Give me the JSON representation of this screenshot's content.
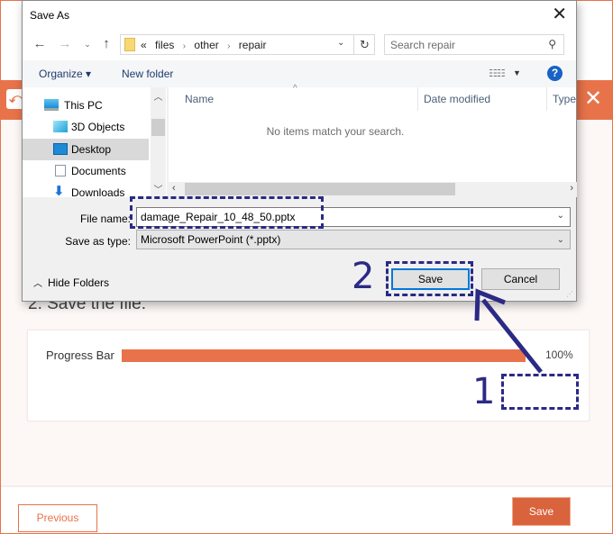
{
  "app": {
    "logo_glyph": "⤺",
    "close_glyph": "✕",
    "step_title": "2. Save the file:",
    "progress": {
      "label": "Progress Bar",
      "value_percent": 100,
      "value_text": "100%"
    },
    "save_button": "Save",
    "previous_button": "Previous",
    "accent_color": "#e8734a"
  },
  "dialog": {
    "title": "Save As",
    "close_glyph": "✕",
    "nav": {
      "back_glyph": "←",
      "forward_glyph": "→",
      "recent_glyph": "⌄",
      "up_glyph": "↑"
    },
    "address": {
      "overflow": "«",
      "crumbs": [
        "files",
        "other",
        "repair"
      ],
      "separator": "›",
      "dropdown_glyph": "⌄",
      "refresh_glyph": "↻"
    },
    "search": {
      "placeholder": "Search repair",
      "value": ""
    },
    "commands": {
      "organize": "Organize ▾",
      "new_folder": "New folder",
      "view_glyph": "☷☷",
      "view_drop_glyph": "▼",
      "help_glyph": "?"
    },
    "nav_pane": {
      "items": [
        {
          "label": "This PC",
          "icon": "computer-icon",
          "selected": false
        },
        {
          "label": "3D Objects",
          "icon": "3d-objects-icon",
          "selected": false
        },
        {
          "label": "Desktop",
          "icon": "desktop-icon",
          "selected": true
        },
        {
          "label": "Documents",
          "icon": "documents-icon",
          "selected": false
        },
        {
          "label": "Downloads",
          "icon": "downloads-icon",
          "selected": false
        }
      ]
    },
    "file_list": {
      "columns": [
        "Name",
        "Date modified",
        "Type"
      ],
      "sort_glyph": "^",
      "empty_message": "No items match your search."
    },
    "form": {
      "file_name_label": "File name:",
      "file_name_value": "damage_Repair_10_48_50.pptx",
      "save_as_type_label": "Save as type:",
      "save_as_type_value": "Microsoft PowerPoint (*.pptx)"
    },
    "hide_folders": "Hide Folders",
    "save_button": "Save",
    "cancel_button": "Cancel"
  },
  "annotations": {
    "step1": "1",
    "step2": "2",
    "color": "#2b2a85"
  }
}
